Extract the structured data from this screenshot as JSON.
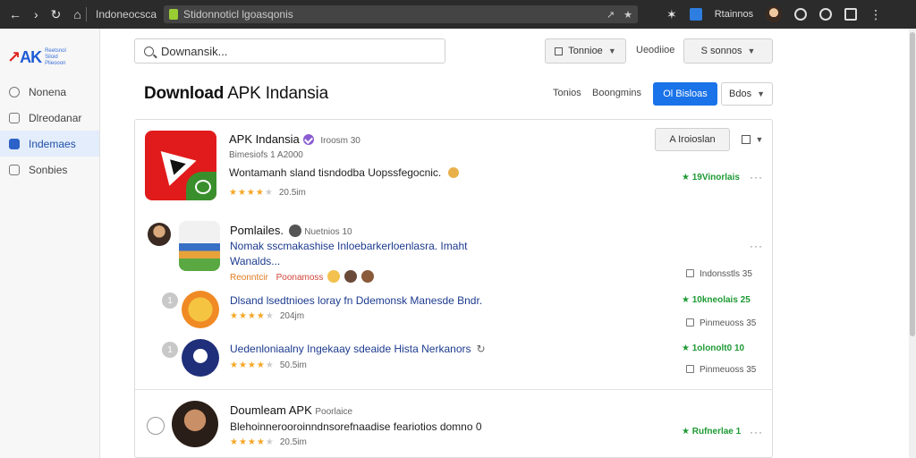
{
  "browser": {
    "tab_title": "Indoneocsca",
    "url": "Stidonnoticl lgoasqonis",
    "profile_label": "Rtainnos"
  },
  "sidebar": {
    "logo_text": "AK",
    "logo_tagline": "Reetsnol Siloid Plieooon",
    "items": [
      {
        "label": "Nonena",
        "icon": "circle-icon"
      },
      {
        "label": "Dlreodanar",
        "icon": "folder-icon"
      },
      {
        "label": "Indemaes",
        "icon": "grid-icon",
        "active": true
      },
      {
        "label": "Sonbies",
        "icon": "list-icon"
      }
    ]
  },
  "toolbar": {
    "search_value": "Downansik...",
    "filter_label": "Tonnioe",
    "updates_label": "Ueodiioe",
    "sort_label": "S sonnos"
  },
  "header": {
    "title_bold": "Download",
    "title_rest": " APK Indansia",
    "link1": "Tonios",
    "link2": "Boongmins",
    "primary_btn": "Ol Bisloas",
    "secondary_btn": "Bdos"
  },
  "featured": {
    "name": "APK Indansia",
    "version": "Iroosm 30",
    "meta": "Bimesiofs 1 A2000",
    "desc": "Wontamanh sland tisndodba Uopssfegocnic.",
    "rating": 4,
    "count": "20.5im",
    "action_btn": "A Iroioslan",
    "downloads": "★ 19Vinorlais"
  },
  "comment": {
    "author": "Pomlailes.",
    "handle": "Nuetnios 10",
    "text_line1": "Nomak sscmakashise Inloebarkerloenlasra. Imaht",
    "text_line2": "Wanalds...",
    "tag1": "Reonntcir",
    "tag2": "Poonamoss"
  },
  "sub_items": [
    {
      "badge": "1",
      "title": "Dlsand lsedtnioes loray fn Ddemonsk Manesde Bndr.",
      "count": "204jm",
      "rating": 4,
      "stat": "★ 10kneolais 25",
      "check": "Pinmeuoss 35"
    },
    {
      "badge": "1",
      "title": "Uedenloniaalny Ingekaay sdeaide Hista Nerkanors",
      "count": "50.5im",
      "rating": 4,
      "stat": "★ 1olonolt0 10",
      "check": "Pinmeuoss 35"
    }
  ],
  "comment_stat": "Indonsstls 35",
  "bottom": {
    "name": "Doumleam APK",
    "sub": "Poorlaice",
    "desc": "Blehoinnerooroinndnsorefnaadise feariotios domno 0",
    "rating": 4,
    "count": "20.5im",
    "stat": "★ Rufnerlae 1"
  }
}
